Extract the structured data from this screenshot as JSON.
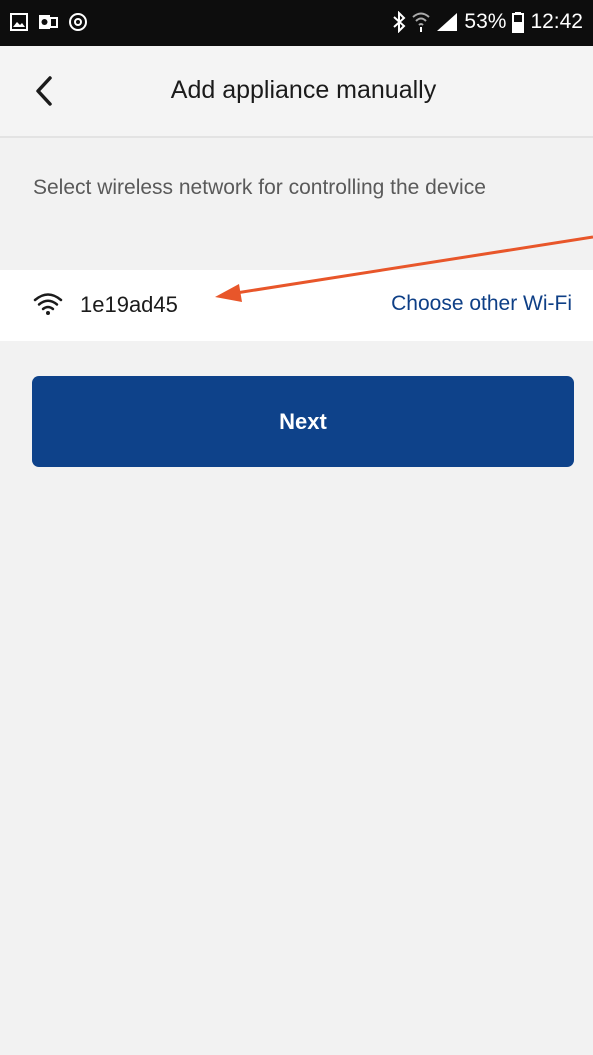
{
  "status_bar": {
    "battery": "53%",
    "time": "12:42"
  },
  "header": {
    "title": "Add appliance manually"
  },
  "instruction": "Select wireless network for controlling the device",
  "network": {
    "ssid": "1e19ad45",
    "choose_other_label": "Choose other Wi-Fi"
  },
  "next_label": "Next",
  "icons": [
    "gallery-icon",
    "outlook-icon",
    "sync-icon",
    "bluetooth-icon",
    "wifi-status-icon",
    "signal-icon",
    "battery-icon",
    "back-icon",
    "wifi-icon"
  ],
  "colors": {
    "primary": "#0e428a",
    "link": "#0e3f86",
    "annotation": "#e8562a"
  }
}
